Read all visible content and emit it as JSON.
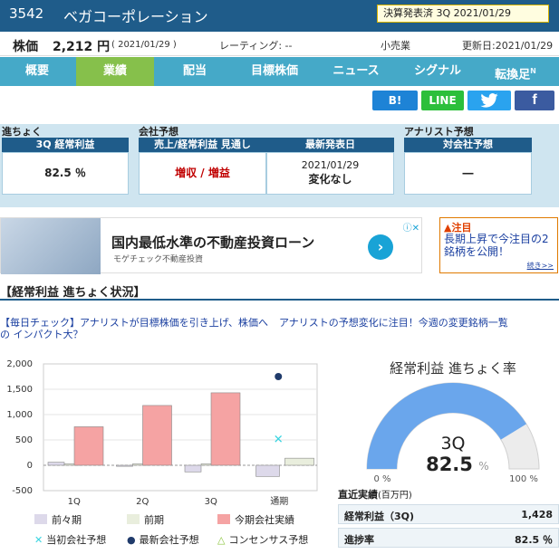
{
  "header": {
    "code": "3542",
    "company": "ベガコーポレーション",
    "earnings_status": "決算発表済 3Q 2021/01/29"
  },
  "price_bar": {
    "label": "株価",
    "value": "2,212 円",
    "date": "( 2021/01/29 )",
    "rating": "レーティング: --",
    "industry": "小売業",
    "updated": "更新日:2021/01/29"
  },
  "nav": {
    "tabs": [
      "概要",
      "業績",
      "配当",
      "目標株価",
      "ニュース",
      "シグナル",
      "転換足"
    ],
    "active": "業績",
    "new_badge": "N"
  },
  "share": {
    "hatena": "B!",
    "line": "LINE",
    "twitter": "twitter",
    "facebook": "f"
  },
  "progress": {
    "section": "進ちょく",
    "head": "3Q 経常利益",
    "value": "82.5 ％"
  },
  "company_forecast": {
    "section": "会社予想",
    "head": "売上/経常利益 見通し",
    "value": "増収 / 増益"
  },
  "latest": {
    "head": "最新発表日",
    "date": "2021/01/29",
    "change": "変化なし"
  },
  "analyst": {
    "section": "アナリスト予想",
    "head": "対会社予想",
    "value": "―"
  },
  "ad": {
    "title": "国内最低水準の不動産投資ローン",
    "sub": "モゲチェック不動産投資",
    "go": "›"
  },
  "notice": {
    "tag": "▲注目",
    "text": "長期上昇で今注目の2銘柄を公開！",
    "more": "続き>>"
  },
  "section_title": "【経常利益 進ちょく状況】",
  "links": {
    "left": "【毎日チェック】アナリストが目標株価を引き上げ、株価への インパクト大？",
    "right": "アナリストの予想変化に注目！今週の変更銘柄一覧"
  },
  "chart_data": {
    "type": "bar",
    "categories": [
      "1Q",
      "2Q",
      "3Q",
      "通期"
    ],
    "ylim": [
      -500,
      2000
    ],
    "yticks": [
      "2,000",
      "1,500",
      "1,000",
      "500",
      "0",
      "-500"
    ],
    "series": [
      {
        "name": "前々期",
        "color": "#ddd9ea",
        "values": [
          60,
          -20,
          -130,
          -220
        ]
      },
      {
        "name": "前期",
        "color": "#e9eedd",
        "values": [
          30,
          30,
          30,
          140
        ]
      },
      {
        "name": "今期会社実績",
        "color": "#f5a3a3",
        "values": [
          760,
          1180,
          1430,
          null
        ]
      }
    ],
    "markers": [
      {
        "name": "当初会社予想",
        "symbol": "✕",
        "color": "#37d4e0",
        "category": "通期",
        "value": 510
      },
      {
        "name": "最新会社予想",
        "symbol": "●",
        "color": "#203b6b",
        "category": "通期",
        "value": 1750
      },
      {
        "name": "コンセンサス予想",
        "symbol": "△",
        "color": "#8cc63f",
        "category": "通期",
        "value": null
      }
    ]
  },
  "gauge": {
    "title": "経常利益 進ちょく率",
    "quarter": "3Q",
    "value": "82.5",
    "unit": "%",
    "percent": 82.5,
    "min_label": "0 %",
    "max_label": "100 %"
  },
  "table": {
    "title": "直近実績",
    "unit": "(百万円)",
    "rows": [
      {
        "label": "経常利益（3Q)",
        "value": "1,428"
      },
      {
        "label": "進捗率",
        "value": "82.5 ％"
      }
    ]
  }
}
